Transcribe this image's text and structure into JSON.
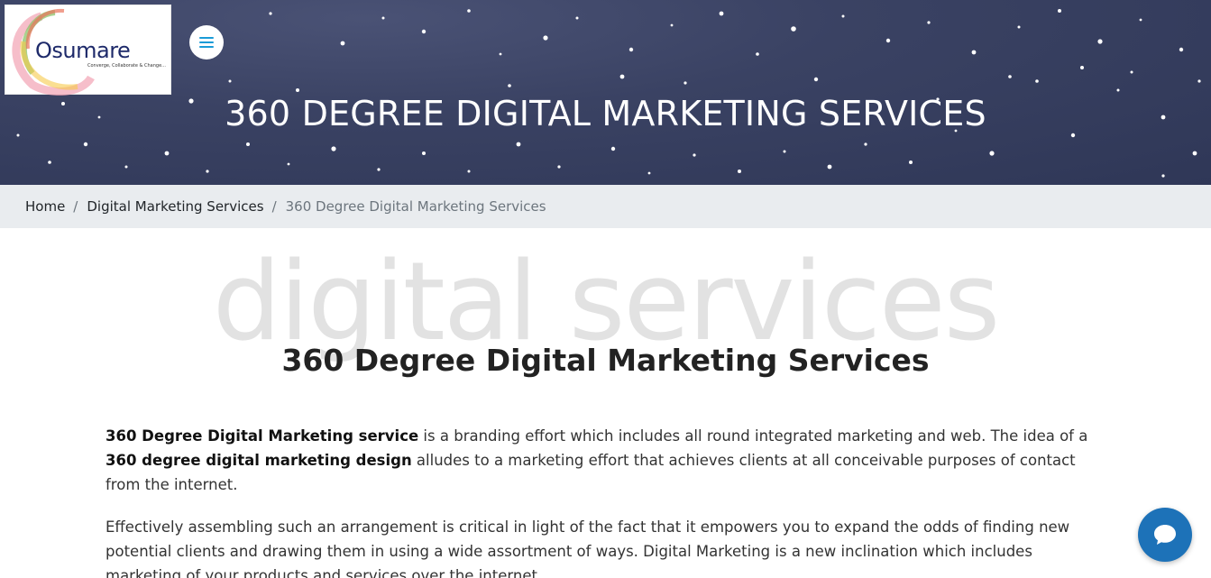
{
  "logo": {
    "word": "Osumare",
    "tagline": "Converge, Collaborate & Change..."
  },
  "hero": {
    "title": "360 DEGREE DIGITAL MARKETING SERVICES"
  },
  "breadcrumb": {
    "items": [
      "Home",
      "Digital Marketing Services"
    ],
    "separator": "/",
    "active": "360 Degree Digital Marketing Services"
  },
  "section": {
    "watermark": "digital services",
    "title": "360 Degree Digital Marketing Services"
  },
  "content": {
    "p1_bold1": "360 Degree Digital Marketing service",
    "p1_text1": " is a branding effort which includes all round integrated marketing and web. The idea of a ",
    "p1_bold2": "360 degree digital marketing design",
    "p1_text2": " alludes to a marketing effort that achieves clients at all conceivable purposes of contact from the internet.",
    "p2": "Effectively assembling such an arrangement is critical in light of the fact that it empowers you to expand the odds of finding new potential clients and drawing them in using a wide assortment of ways. Digital Marketing is a new inclination which includes marketing of your products and services over the internet."
  },
  "icons": {
    "menu": "hamburger-menu-icon",
    "chat": "chat-bubble-icon"
  },
  "colors": {
    "hero_bg": "#353d5e",
    "accent": "#1a9bd7",
    "chat": "#1d72b8",
    "breadcrumb_bg": "#e9ecef"
  }
}
